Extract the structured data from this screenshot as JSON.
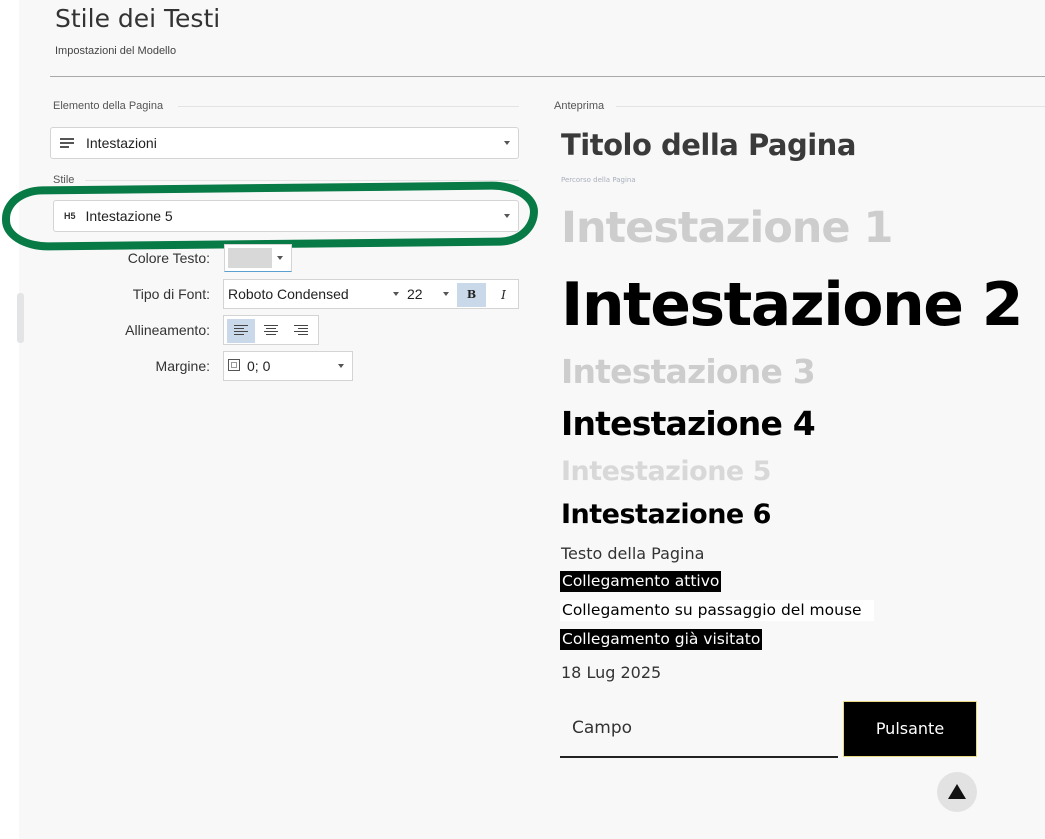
{
  "header": {
    "title": "Stile dei Testi",
    "subtitle": "Impostazioni del Modello"
  },
  "left": {
    "element_group_label": "Elemento della Pagina",
    "element_icon": "text-lines-icon",
    "element_value": "Intestazioni",
    "style_group_label": "Stile",
    "style_icon": "H5",
    "style_value": "Intestazione 5",
    "fields": {
      "text_color_label": "Colore Testo:",
      "text_color_value": "#d8d8d8",
      "font_label": "Tipo di Font:",
      "font_family": "Roboto Condensed",
      "font_size": "22",
      "bold_label": "B",
      "bold_active": true,
      "italic_label": "I",
      "italic_active": false,
      "alignment_label": "Allineamento:",
      "alignment_selected": "left",
      "margin_label": "Margine:",
      "margin_value": "0; 0"
    }
  },
  "preview": {
    "group_label": "Anteprima",
    "page_title": "Titolo della Pagina",
    "breadcrumb": "Percorso della Pagina",
    "headings": [
      "Intestazione 1",
      "Intestazione 2",
      "Intestazione 3",
      "Intestazione 4",
      "Intestazione 5",
      "Intestazione 6"
    ],
    "body_text": "Testo della Pagina",
    "link_active": "Collegamento attivo",
    "link_hover": "Collegamento su passaggio del mouse",
    "link_visited": "Collegamento già visitato",
    "date": "18 Lug 2025",
    "input_placeholder": "Campo",
    "button_label": "Pulsante"
  },
  "colors": {
    "highlight_ring": "#077a45",
    "selected_toggle": "#c9d9ea",
    "muted_heading": "#cdcdcd"
  }
}
